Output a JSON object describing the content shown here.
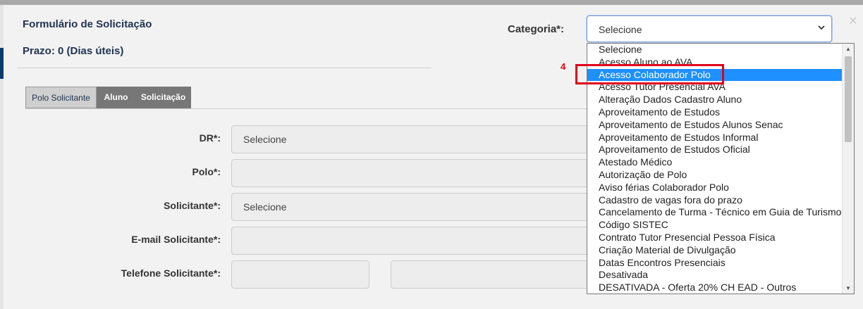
{
  "modal": {
    "title": "Formulário de Solicitação",
    "prazo": "Prazo: 0 (Dias úteis)",
    "close_icon": "×"
  },
  "categoria": {
    "label": "Categoria*:",
    "selected": "Selecione",
    "chevron": "⌄",
    "options": [
      "Selecione",
      "Acesso Aluno ao AVA",
      "Acesso Colaborador Polo",
      "Acesso Tutor Presencial AVA",
      "Alteração Dados Cadastro Aluno",
      "Aproveitamento de Estudos",
      "Aproveitamento de Estudos Alunos Senac",
      "Aproveitamento de Estudos Informal",
      "Aproveitamento de Estudos Oficial",
      "Atestado Médico",
      "Autorização de Polo",
      "Aviso férias Colaborador Polo",
      "Cadastro de vagas fora do prazo",
      "Cancelamento de Turma - Técnico em Guia de Turismo",
      "Código SISTEC",
      "Contrato Tutor Presencial Pessoa Física",
      "Criação Material de Divulgação",
      "Datas Encontros Presenciais",
      "Desativada",
      "DESATIVADA - Oferta 20% CH EAD - Outros"
    ],
    "highlighted_index": 2
  },
  "tabs": [
    {
      "label": "Polo Solicitante",
      "active": true
    },
    {
      "label": "Aluno",
      "active": false
    },
    {
      "label": "Solicitação",
      "active": false
    }
  ],
  "fields": {
    "dr": {
      "label": "DR*:",
      "value": "Selecione"
    },
    "polo": {
      "label": "Polo*:",
      "value": ""
    },
    "solicitante": {
      "label": "Solicitante*:",
      "value": "Selecione"
    },
    "email": {
      "label": "E-mail Solicitante*:",
      "value": ""
    },
    "telefone": {
      "label": "Telefone Solicitante*:",
      "value": ""
    }
  },
  "annotation": {
    "step_number": "4",
    "highlight_color": "#e0001b"
  },
  "colors": {
    "option_highlight": "#1e90ff",
    "title": "#1f3350"
  }
}
